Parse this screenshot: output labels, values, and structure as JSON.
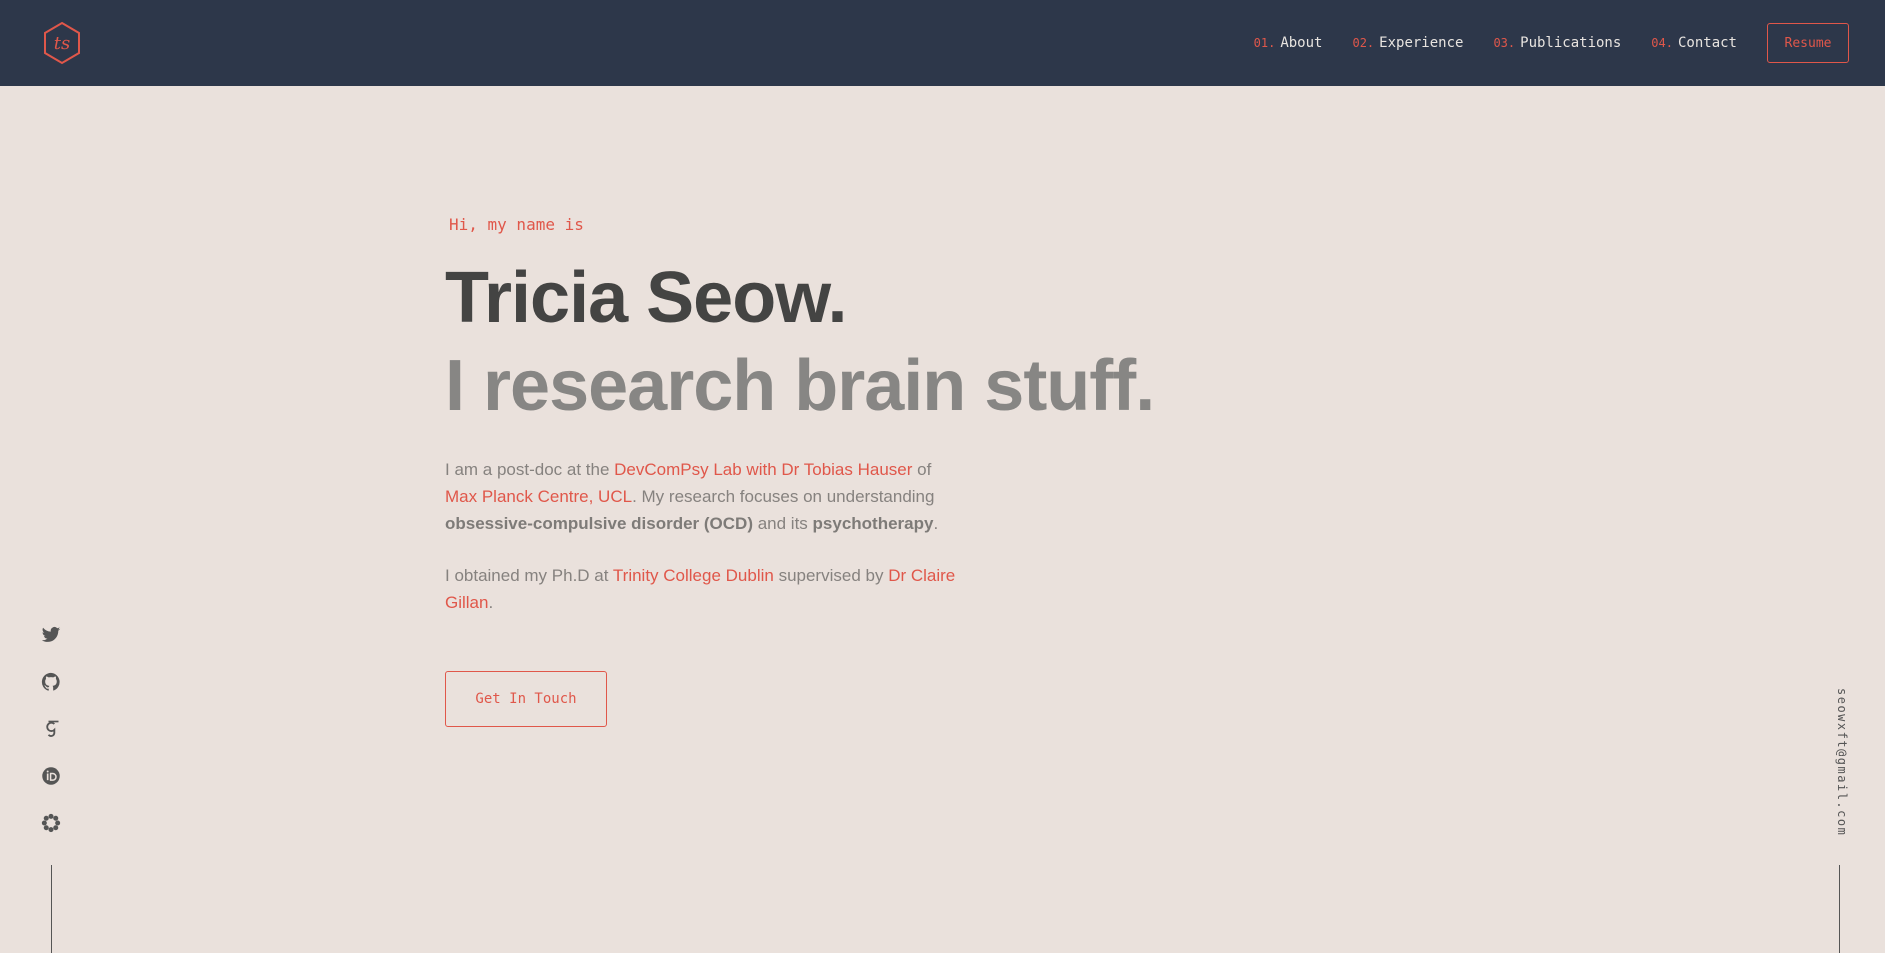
{
  "colors": {
    "nav_bg": "#2d374a",
    "page_bg": "#eae1dc",
    "accent": "#e0574a",
    "heading": "#444443",
    "subheading": "#878684"
  },
  "logo": {
    "text": "ts"
  },
  "nav": {
    "items": [
      {
        "num": "01.",
        "label": "About"
      },
      {
        "num": "02.",
        "label": "Experience"
      },
      {
        "num": "03.",
        "label": "Publications"
      },
      {
        "num": "04.",
        "label": "Contact"
      }
    ],
    "resume_label": "Resume"
  },
  "hero": {
    "greeting": "Hi, my name is",
    "name": "Tricia Seow.",
    "tagline": "I research brain stuff.",
    "bio1": {
      "t1": "I am a post-doc at the ",
      "link1": "DevComPsy Lab with Dr Tobias Hauser",
      "t2": " of ",
      "link2": "Max Planck Centre, UCL",
      "t3": ". My research focuses on understanding ",
      "b1": "obsessive-compulsive disorder (OCD)",
      "t4": " and its ",
      "b2": "psychotherapy",
      "t5": "."
    },
    "bio2": {
      "t1": "I obtained my Ph.D at ",
      "link1": "Trinity College Dublin",
      "t2": " supervised by ",
      "link2": "Dr Claire Gillan",
      "t3": "."
    },
    "cta_label": "Get In Touch"
  },
  "socials": [
    "twitter-icon",
    "github-icon",
    "google-scholar-icon",
    "orcid-icon",
    "researchgate-icon"
  ],
  "email": "seowxft@gmail.com"
}
